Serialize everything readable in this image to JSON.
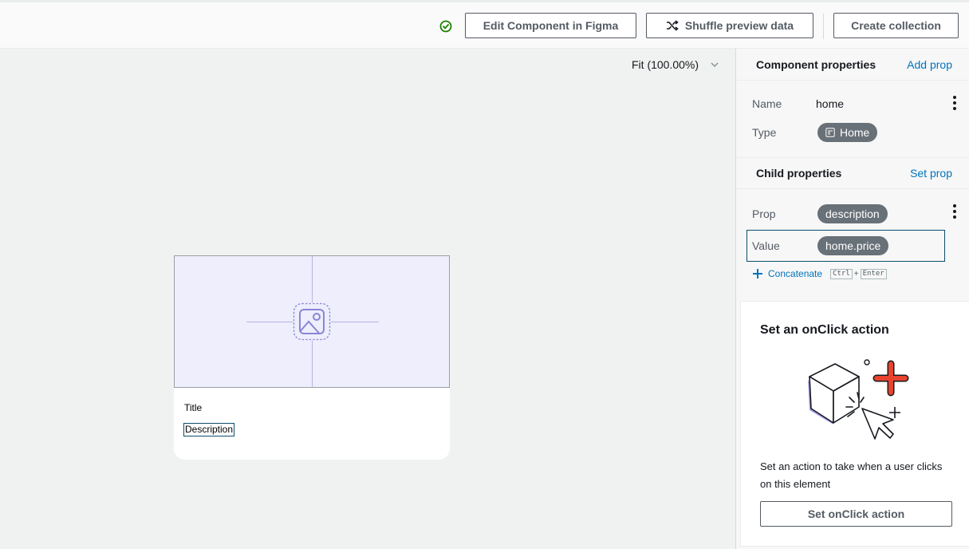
{
  "toolbar": {
    "edit_figma_label": "Edit Component in Figma",
    "shuffle_label": "Shuffle preview data",
    "create_collection_label": "Create collection"
  },
  "canvas": {
    "zoom_label": "Fit (100.00%)",
    "card": {
      "title": "Title",
      "description": "Description"
    }
  },
  "panel": {
    "component_properties": {
      "title": "Component properties",
      "action": "Add prop",
      "name_label": "Name",
      "name_value": "home",
      "type_label": "Type",
      "type_value": "Home"
    },
    "child_properties": {
      "title": "Child properties",
      "action": "Set prop",
      "prop_label": "Prop",
      "prop_value": "description",
      "value_label": "Value",
      "value_value": "home.price",
      "concatenate_label": "Concatenate",
      "shortcut_ctrl": "Ctrl",
      "shortcut_plus": "+",
      "shortcut_enter": "Enter"
    },
    "onclick": {
      "title": "Set an onClick action",
      "text": "Set an action to take when a user clicks on this element",
      "button_label": "Set onClick action"
    }
  },
  "colors": {
    "link": "#0073bb",
    "status_ok": "#1d8102",
    "pill": "#687078",
    "accent_red": "#e8432e",
    "placeholder_bg": "#eeeefc"
  },
  "icons": [
    "check-circle-icon",
    "shuffle-icon",
    "chevron-down-icon",
    "image-placeholder-icon",
    "kebab-menu-icon",
    "component-type-icon",
    "plus-icon"
  ]
}
